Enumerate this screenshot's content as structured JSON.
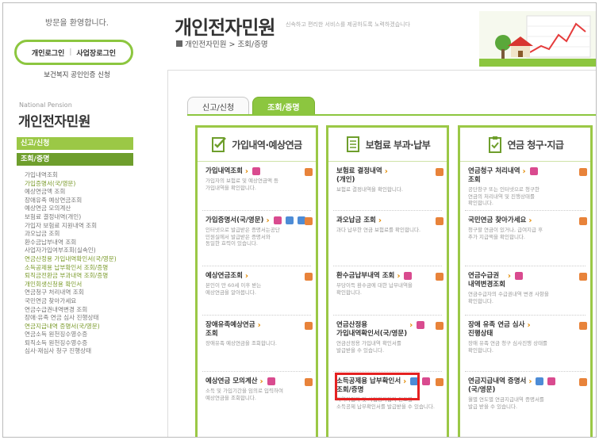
{
  "sidebar": {
    "welcome": "방문을 환영합니다.",
    "personal_login": "개인로그인",
    "business_login": "사업장로그인",
    "cert": "보건복지 공인인증 신청",
    "np_label": "National Pension",
    "title": "개인전자민원",
    "tab_report": "신고/신청",
    "tab_inquiry": "조회/증명",
    "menu": [
      {
        "label": "가입내역조회",
        "hl": false
      },
      {
        "label": "가입증명서(국/영문)",
        "hl": true
      },
      {
        "label": "예상연금액 조회",
        "hl": false
      },
      {
        "label": "장애유족 예상연금조회",
        "hl": false
      },
      {
        "label": "예상연금 모의계산",
        "hl": false
      },
      {
        "label": "보험료 결정내역(개인)",
        "hl": false
      },
      {
        "label": "가입자 보험료 지원내역 조회",
        "hl": false
      },
      {
        "label": "과오납금 조회",
        "hl": false
      },
      {
        "label": "환수금납부내역 조회",
        "hl": false
      },
      {
        "label": "사업자가입여부조회(실속인)",
        "hl": false
      },
      {
        "label": "연금산정용 가입내역확인서(국/영문)",
        "hl": true
      },
      {
        "label": "소득공제용 납부확인서 조회/증명",
        "hl": true
      },
      {
        "label": "퇴직금전환금 부과내역 조회/증명",
        "hl": true
      },
      {
        "label": "개인회생신청용 확인서",
        "hl": true
      },
      {
        "label": "연금청구 처리내역 조회",
        "hl": false
      },
      {
        "label": "국민연금 찾아가세요",
        "hl": false
      },
      {
        "label": "연금수급권내역변경 조회",
        "hl": false
      },
      {
        "label": "장애·유족 연금 심사 진행상태",
        "hl": false
      },
      {
        "label": "연금지급내역 증명서(국/영문)",
        "hl": true
      },
      {
        "label": "연금소득 원천징수영수증",
        "hl": false
      },
      {
        "label": "퇴직소득 원천징수영수증",
        "hl": false
      },
      {
        "label": "심사·재심사 청구 진행상태",
        "hl": false
      }
    ]
  },
  "header": {
    "title": "개인전자민원",
    "subtitle": "신속하고 편리한 서비스를 제공하도록 노력하겠습니다",
    "breadcrumb": "개인전자민원 > 조회/증명"
  },
  "tabs": [
    {
      "label": "신고/신청",
      "active": false
    },
    {
      "label": "조회/증명",
      "active": true
    }
  ],
  "columns": [
    {
      "title": "가입내역·예상연금",
      "icon": "checklist-icon",
      "items": [
        {
          "name": "가입내역조회",
          "desc": "가입자의 보험료 및 예상연금액 등\n가입내역을 확인합니다."
        },
        {
          "name": "가입증명서(국/영문)",
          "desc": "인터넷으로 발급받은 증명서는공단\n민원실에서 발급받은 증명서와\n동일한 효력이 있습니다."
        },
        {
          "name": "예상연금조회",
          "desc": "본인이 만 60세 이후 받는\n예상연금을 알아봅니다."
        },
        {
          "name": "장애유족예상연금\n조회",
          "desc": "장애유족 예상연금을 조회합니다."
        },
        {
          "name": "예상연금 모의계산",
          "desc": "소득 및 가입기간을 임의로 입력하여\n예상연금을 조회합니다."
        }
      ]
    },
    {
      "title": "보험료 부과·납부",
      "icon": "list-doc-icon",
      "items": [
        {
          "name": "보험료 결정내역\n(개인)",
          "desc": "보험료 결정내역을 확인합니다."
        },
        {
          "name": "과오납금 조회",
          "desc": "과다 납부한 연금 보험료를 확인합니다."
        },
        {
          "name": "환수금납부내역 조회",
          "desc": "부당이득 환수금에 대한 납부내역을\n확인합니다."
        },
        {
          "name": "연금산정용\n가입내역확인서(국/영문)",
          "desc": "연금산정용 가입내역 확인서를\n발급받을 수 있습니다."
        },
        {
          "name": "소득공제용 납부확인서\n조회/증명",
          "desc": "지역가입자 및 사업장가입자 연도별\n소득공제 납부확인서를 발급받을 수 있습니다."
        }
      ]
    },
    {
      "title": "연금 청구·지급",
      "icon": "clipboard-check-icon",
      "items": [
        {
          "name": "연금청구 처리내역\n조회",
          "desc": "공단창구 또는 인터넷으로 청구한\n연금의 처리내역 및 진행상태를\n확인합니다."
        },
        {
          "name": "국민연금 찾아가세요",
          "desc": "청구할 연금이 있거나, 급여지급 후\n추가 지급액을 확인합니다."
        },
        {
          "name": "연금수급권\n내역변경조회",
          "desc": "연금수급자의 수급권내역 변경 사항을\n확인합니다."
        },
        {
          "name": "장애 유족 연금 심사\n진행상태",
          "desc": "장애 유족 연금 청구 심사진행 상태를\n확인합니다."
        },
        {
          "name": "연금지급내역 증명서\n(국/영문)",
          "desc": "월별 연도별 연금지급내역 증명서를\n발급 받을 수 있습니다."
        }
      ]
    }
  ]
}
